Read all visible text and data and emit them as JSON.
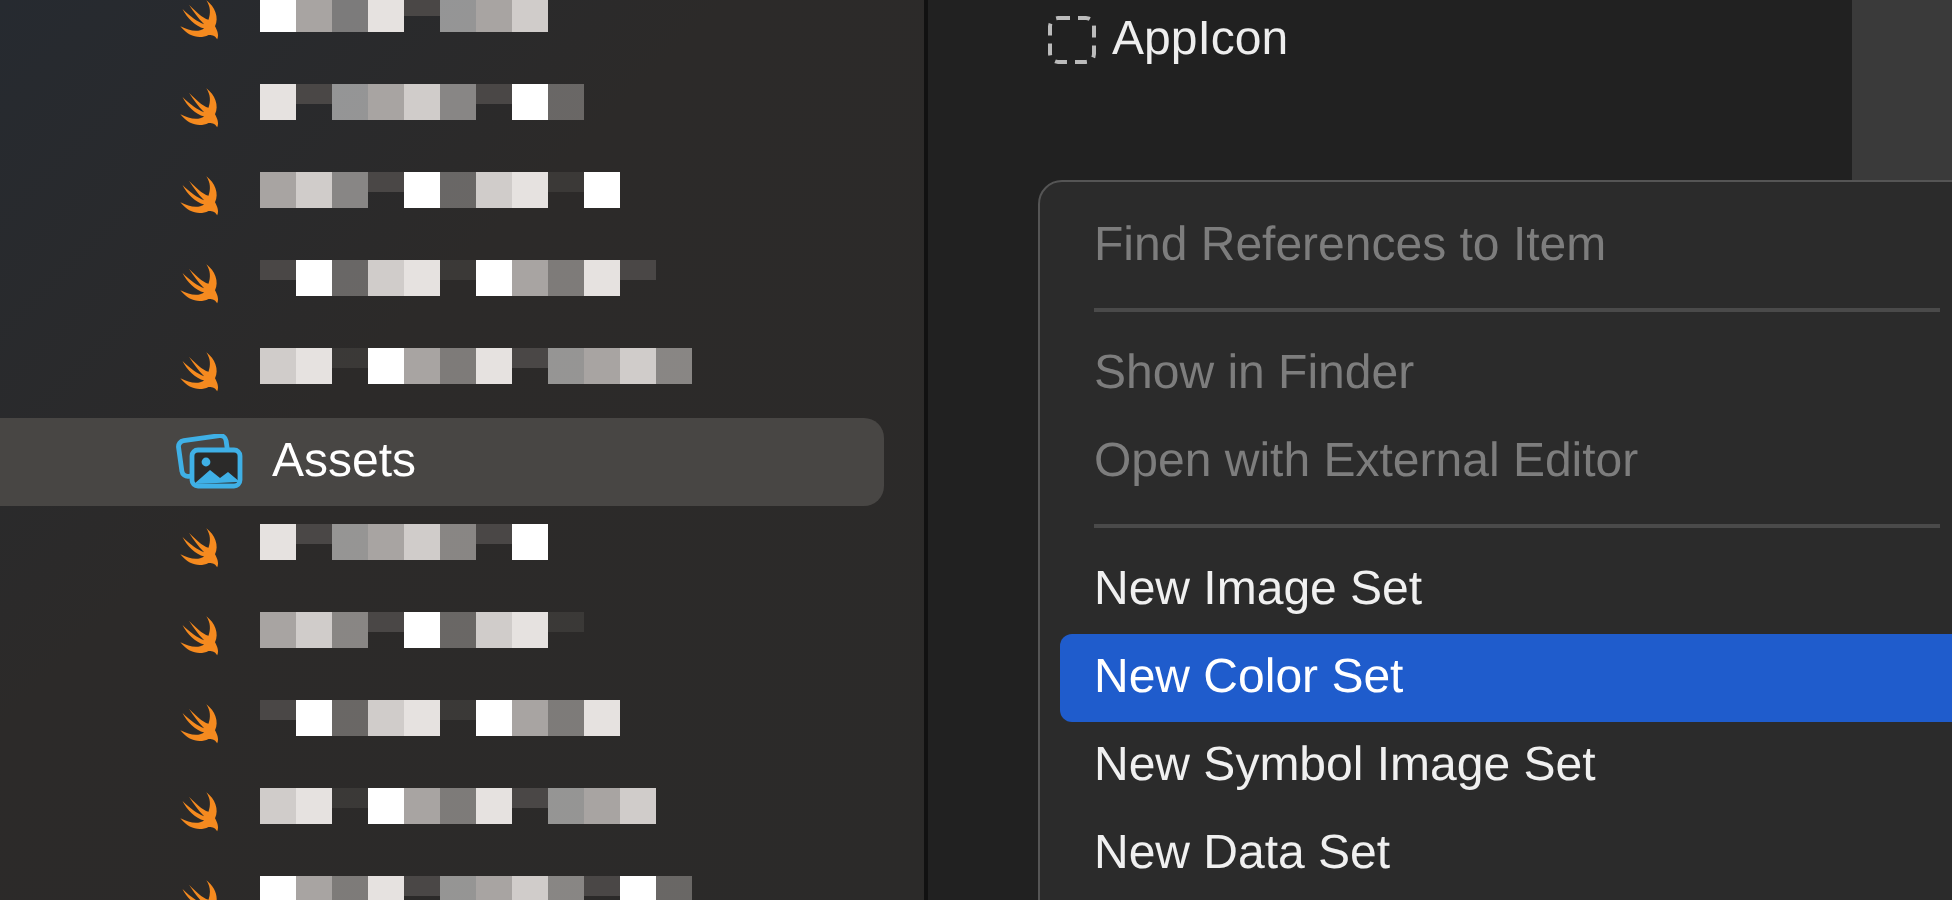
{
  "navigator": {
    "items": [
      {
        "kind": "swift-file",
        "selected": false
      },
      {
        "kind": "swift-file",
        "selected": false
      },
      {
        "kind": "swift-file",
        "selected": false
      },
      {
        "kind": "swift-file",
        "selected": false
      },
      {
        "kind": "swift-file",
        "selected": false
      },
      {
        "kind": "asset-catalog",
        "label": "Assets",
        "selected": true
      },
      {
        "kind": "swift-file",
        "selected": false
      },
      {
        "kind": "swift-file",
        "selected": false
      },
      {
        "kind": "swift-file",
        "selected": false
      },
      {
        "kind": "swift-file",
        "selected": false
      },
      {
        "kind": "swift-file",
        "selected": false
      }
    ]
  },
  "asset_list": {
    "items": [
      {
        "label": "AppIcon"
      }
    ]
  },
  "context_menu": {
    "items": [
      {
        "kind": "item",
        "label": "Find References to Item",
        "disabled": true,
        "selected": false
      },
      {
        "kind": "separator"
      },
      {
        "kind": "item",
        "label": "Show in Finder",
        "disabled": true,
        "selected": false
      },
      {
        "kind": "item",
        "label": "Open with External Editor",
        "disabled": true,
        "selected": false
      },
      {
        "kind": "separator"
      },
      {
        "kind": "item",
        "label": "New Image Set",
        "disabled": false,
        "selected": false
      },
      {
        "kind": "item",
        "label": "New Color Set",
        "disabled": false,
        "selected": true
      },
      {
        "kind": "item",
        "label": "New Symbol Image Set",
        "disabled": false,
        "selected": false
      },
      {
        "kind": "item",
        "label": "New Data Set",
        "disabled": false,
        "selected": false
      }
    ]
  }
}
